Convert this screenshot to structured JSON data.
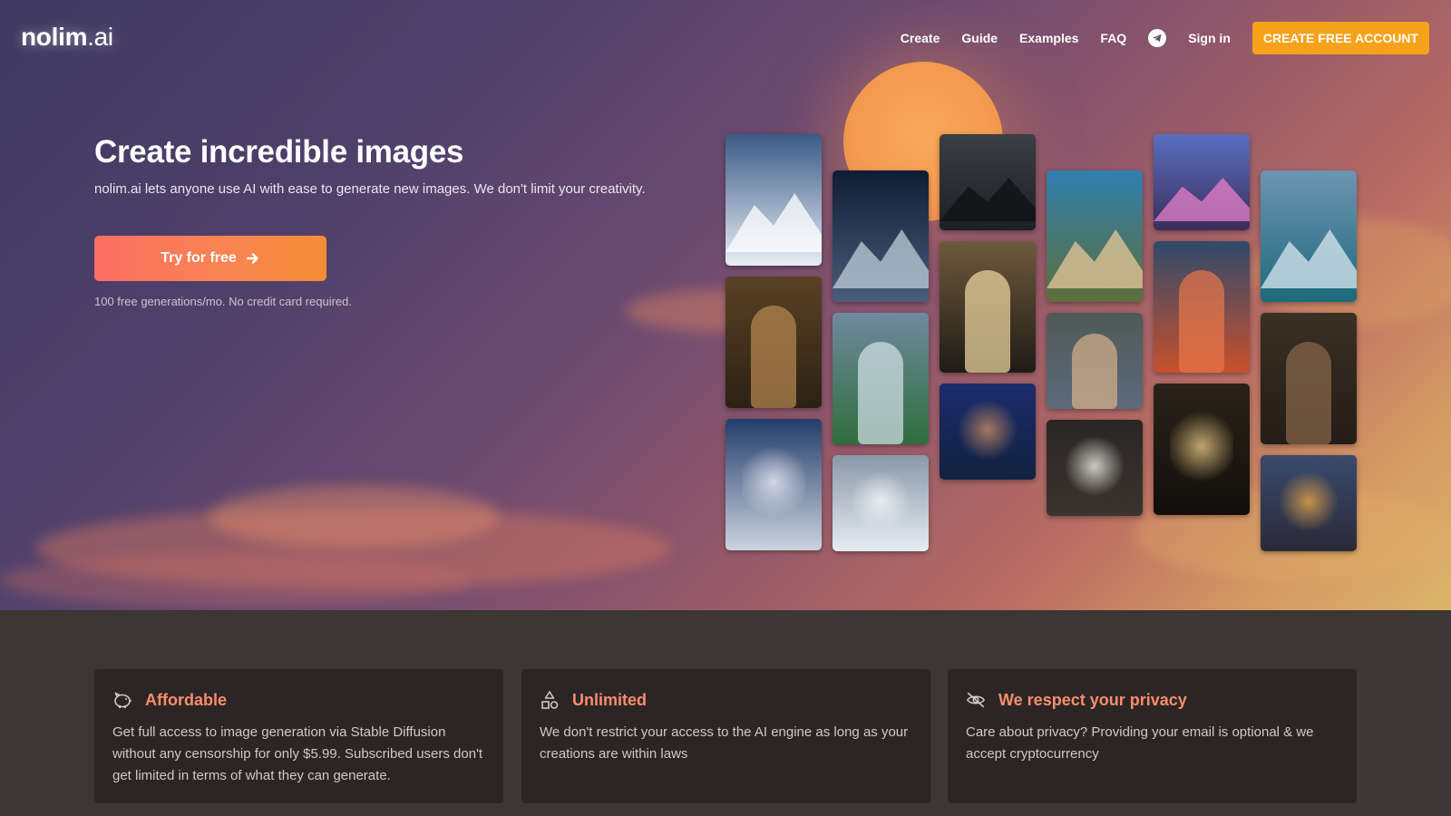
{
  "brand": {
    "logo_bold": "nolim",
    "logo_light": ".ai"
  },
  "nav": {
    "links": [
      "Create",
      "Guide",
      "Examples",
      "FAQ"
    ],
    "sign_in": "Sign in",
    "cta": "CREATE FREE ACCOUNT"
  },
  "hero": {
    "title": "Create incredible images",
    "subtitle": "nolim.ai lets anyone use AI with ease to generate new images. We don't limit your creativity.",
    "button": "Try for free",
    "note": "100 free generations/mo. No credit card required."
  },
  "gallery": {
    "images": [
      {
        "name": "snowy-mountain-sunburst",
        "top": "#3b5a86",
        "bottom": "#e7eef6",
        "motif": "#ffffff"
      },
      {
        "name": "monkey-family-portrait",
        "top": "#5a4224",
        "bottom": "#2b2114",
        "motif": "#b98a52"
      },
      {
        "name": "mountain-range-moon",
        "top": "#233d6b",
        "bottom": "#cbd3de",
        "motif": "#e9e9f2"
      },
      {
        "name": "cyborg-woman",
        "top": "#0f1c33",
        "bottom": "#4a5e7c",
        "motif": "#c0ccd8"
      },
      {
        "name": "glass-villa-pool",
        "top": "#6f8aa0",
        "bottom": "#2f6e3c",
        "motif": "#d6e3ea"
      },
      {
        "name": "white-haired-woman",
        "top": "#8a98a8",
        "bottom": "#e6ecf2",
        "motif": "#f4f7fa"
      },
      {
        "name": "businessman-city",
        "top": "#3a3f45",
        "bottom": "#1d2024",
        "motif": "#0f1113"
      },
      {
        "name": "chandelier-lobby",
        "top": "#6e5a3c",
        "bottom": "#1f1b16",
        "motif": "#f4dca4"
      },
      {
        "name": "cyberpunk-bearded-man",
        "top": "#1b2c6c",
        "bottom": "#112240",
        "motif": "#c88a60"
      },
      {
        "name": "coastal-villa",
        "top": "#2f7fae",
        "bottom": "#5e6f3a",
        "motif": "#e6c89a"
      },
      {
        "name": "renaissance-woman",
        "top": "#4e5a56",
        "bottom": "#5e6a7a",
        "motif": "#d8b08c"
      },
      {
        "name": "bunny-hat-dog",
        "top": "#2a2624",
        "bottom": "#3a342f",
        "motif": "#f2efe9"
      },
      {
        "name": "colorful-haired-girl",
        "top": "#5a6ec0",
        "bottom": "#3c2c5a",
        "motif": "#e680c8"
      },
      {
        "name": "sunset-mountain-peak",
        "top": "#2f4a6c",
        "bottom": "#c8502c",
        "motif": "#e8784a"
      },
      {
        "name": "luxury-hallway",
        "top": "#2a2218",
        "bottom": "#120f0c",
        "motif": "#e8c884"
      },
      {
        "name": "modern-house-pool",
        "top": "#6e94b2",
        "bottom": "#1d6a7c",
        "motif": "#dae8f0"
      },
      {
        "name": "monkey-group",
        "top": "#3a3024",
        "bottom": "#241c16",
        "motif": "#8a6a4c"
      },
      {
        "name": "night-city-lights",
        "top": "#3a4a6c",
        "bottom": "#2a2a38",
        "motif": "#e8a848"
      }
    ]
  },
  "features": [
    {
      "title": "Affordable",
      "body": "Get full access to image generation via Stable Diffusion without any censorship for only $5.99. Subscribed users don't get limited in terms of what they can generate.",
      "icon": "piggy-bank-icon"
    },
    {
      "title": "Unlimited",
      "body": "We don't restrict your access to the AI engine as long as your creations are within laws",
      "icon": "shapes-icon"
    },
    {
      "title": "We respect your privacy",
      "body": "Care about privacy? Providing your email is optional & we accept cryptocurrency",
      "icon": "eye-slash-icon"
    }
  ],
  "colors": {
    "accent_orange": "#f7a21b",
    "feature_title": "#fb8c6d",
    "card_bg": "#2b2625",
    "section_bg": "#3c3635"
  }
}
